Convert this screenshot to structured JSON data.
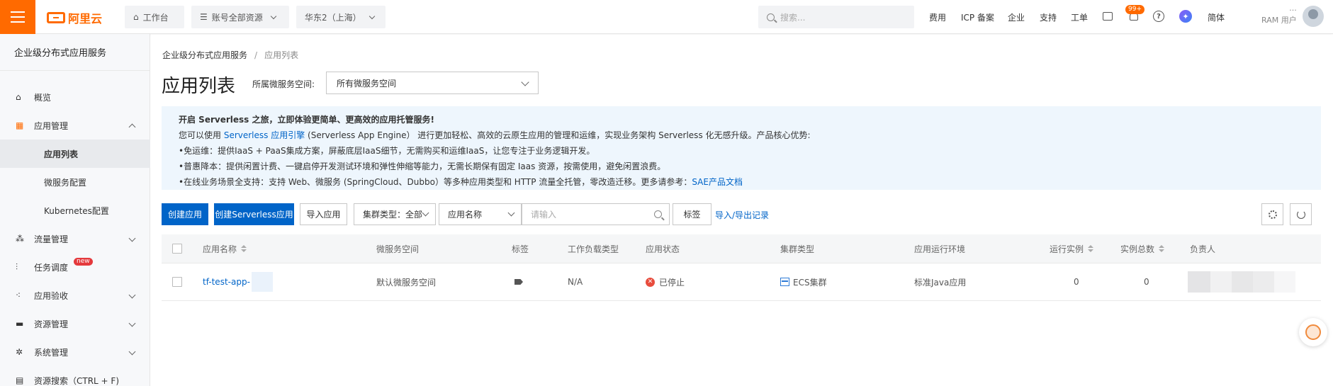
{
  "topbar": {
    "logo_text": "阿里云",
    "workbench": "工作台",
    "account_scope": "账号全部资源",
    "region": "华东2（上海）",
    "search_placeholder": "搜索...",
    "nav": [
      "费用",
      "ICP 备案",
      "企业",
      "支持",
      "工单"
    ],
    "notification_badge": "99+",
    "help_glyph": "?",
    "assistant_glyph": "✦",
    "language": "简体",
    "user_dots": "···",
    "user_role": "RAM 用户",
    "accent": "#ff6a00"
  },
  "sidebar": {
    "title": "企业级分布式应用服务",
    "items": [
      {
        "label": "概览",
        "icon": "home-icon"
      },
      {
        "label": "应用管理",
        "icon": "app-grid-icon"
      },
      {
        "label": "应用列表"
      },
      {
        "label": "微服务配置"
      },
      {
        "label": "Kubernetes配置"
      },
      {
        "label": "流量管理",
        "icon": "traffic-icon"
      },
      {
        "label": "任务调度",
        "icon": "schedule-icon",
        "badge": "new"
      },
      {
        "label": "应用验收",
        "icon": "acceptance-icon"
      },
      {
        "label": "资源管理",
        "icon": "folder-icon"
      },
      {
        "label": "系统管理",
        "icon": "gear-icon"
      },
      {
        "label": "资源搜索（CTRL + F)",
        "icon": "resource-search-icon"
      }
    ]
  },
  "main": {
    "breadcrumb": {
      "root": "企业级分布式应用服务",
      "sep": "/",
      "current": "应用列表"
    },
    "title": "应用列表",
    "namespace_label": "所属微服务空间:",
    "namespace_value": "所有微服务空间",
    "notice": {
      "head": "开启 Serverless 之旅，立即体验更简单、更高效的应用托管服务!",
      "line1_pre": "您可以使用 ",
      "line1_link": "Serverless 应用引擎",
      "line1_post": " (Serverless App Engine） 进行更加轻松、高效的云原生应用的管理和运维，实现业务架构 Serverless 化无感升级。产品核心优势:",
      "line2": "•免运维：提供IaaS + PaaS集成方案，屏蔽底层IaaS细节，无需购买和运维IaaS，让您专注于业务逻辑开发。",
      "line3": "•普惠降本：提供闲置计费、一键启停开发测试环境和弹性伸缩等能力，无需长期保有固定 Iaas 资源，按需使用，避免闲置浪费。",
      "line4_pre": "•在线业务场景全支持：支持 Web、微服务 (SpringCloud、Dubbo）等多种应用类型和 HTTP 流量全托管，零改造迁移。更多请参考：",
      "line4_link": "SAE产品文档"
    },
    "toolbar": {
      "create_app": "创建应用",
      "create_serverless": "创建Serverless应用",
      "import_app": "导入应用",
      "cluster_type": "集群类型：全部",
      "app_name_filter": "应用名称",
      "input_placeholder": "请输入",
      "tag": "标签",
      "import_export": "导入/导出记录"
    },
    "table": {
      "headers": [
        "应用名称",
        "微服务空间",
        "标签",
        "工作负载类型",
        "应用状态",
        "集群类型",
        "应用运行环境",
        "运行实例",
        "实例总数",
        "负责人"
      ],
      "rows": [
        {
          "name": "tf-test-app-",
          "namespace": "默认微服务空间",
          "workload": "N/A",
          "status": "已停止",
          "status_glyph": "✕",
          "cluster": "ECS集群",
          "runtime": "标准Java应用",
          "running": "0",
          "total": "0"
        }
      ]
    }
  }
}
